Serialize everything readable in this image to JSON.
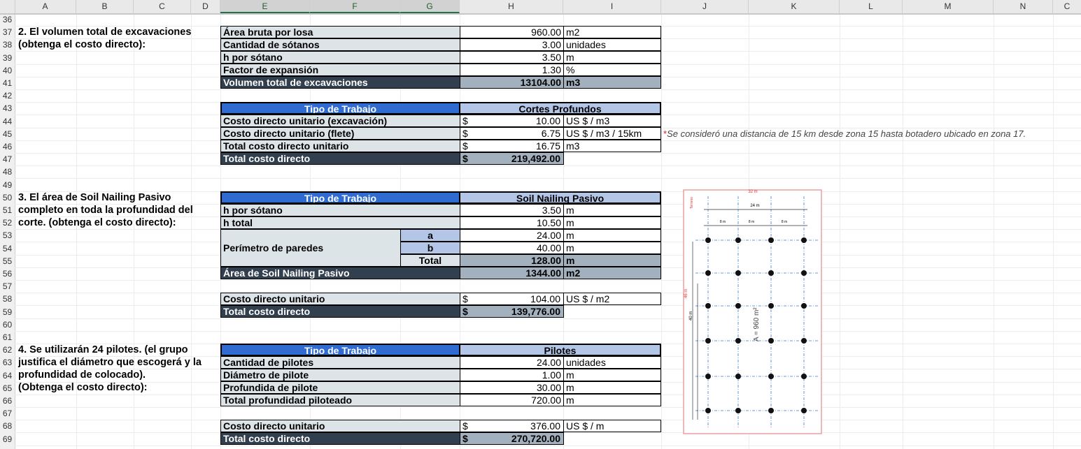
{
  "columns": [
    "A",
    "B",
    "C",
    "D",
    "E",
    "F",
    "G",
    "H",
    "I",
    "J",
    "K",
    "L",
    "M",
    "N",
    "C"
  ],
  "rows": [
    "36",
    "37",
    "38",
    "39",
    "40",
    "41",
    "42",
    "43",
    "44",
    "45",
    "46",
    "47",
    "48",
    "49",
    "50",
    "51",
    "52",
    "53",
    "54",
    "55",
    "56",
    "57",
    "58",
    "59",
    "60",
    "61",
    "62",
    "63",
    "64",
    "65",
    "66",
    "67",
    "68",
    "69"
  ],
  "q2": {
    "text1": "2. El volumen total de excavaciones",
    "text2": "(obtenga el costo directo):",
    "rows": [
      {
        "label": "Área bruta por losa",
        "value": "960.00",
        "unit": "m2"
      },
      {
        "label": "Cantidad de sótanos",
        "value": "3.00",
        "unit": "unidades"
      },
      {
        "label": "h por sótano",
        "value": "3.50",
        "unit": "m"
      },
      {
        "label": "Factor de expansión",
        "value": "1.30",
        "unit": "%"
      }
    ],
    "total": {
      "label": "Volumen total de excavaciones",
      "value": "13104.00",
      "unit": "m3"
    },
    "header": {
      "left": "Tipo de Trabajo",
      "right": "Cortes Profundos"
    },
    "cost_rows": [
      {
        "label": "Costo directo unitario (excavación)",
        "currency": "$",
        "value": "10.00",
        "unit": "US $ / m3"
      },
      {
        "label": "Costo directo unitario (flete)",
        "currency": "$",
        "value": "6.75",
        "unit": "US $ / m3 / 15km"
      },
      {
        "label": "Total costo directo unitario",
        "currency": "$",
        "value": "16.75",
        "unit": "m3"
      }
    ],
    "cost_total": {
      "label": "Total costo directo",
      "currency": "$",
      "value": "219,492.00"
    },
    "note_star": "*",
    "note": "Se consideró una distancia de 15 km desde zona 15 hasta botadero ubicado en zona 17."
  },
  "q3": {
    "text1": "3. El área de Soil Nailing Pasivo",
    "text2": "completo en toda la profundidad del",
    "text3": "corte. (obtenga el costo directo):",
    "header": {
      "left": "Tipo de Trabajo",
      "right": "Soil Nailing Pasivo"
    },
    "rows": [
      {
        "label": "h por sótano",
        "value": "3.50",
        "unit": "m"
      },
      {
        "label": "h total",
        "value": "10.50",
        "unit": "m"
      }
    ],
    "perimeter": {
      "label": "Perímetro de paredes",
      "a_label": "a",
      "a_value": "24.00",
      "a_unit": "m",
      "b_label": "b",
      "b_value": "40.00",
      "b_unit": "m",
      "total_label": "Total",
      "total_value": "128.00",
      "total_unit": "m"
    },
    "area": {
      "label": "Área de Soil Nailing Pasivo",
      "value": "1344.00",
      "unit": "m2"
    },
    "unit_cost": {
      "label": "Costo directo unitario",
      "currency": "$",
      "value": "104.00",
      "unit": "US $ / m2"
    },
    "cost_total": {
      "label": "Total costo directo",
      "currency": "$",
      "value": "139,776.00"
    }
  },
  "q4": {
    "text1": "4. Se utilizarán 24 pilotes. (el grupo",
    "text2": "justifica el diámetro que escogerá y la",
    "text3": "profundidad de colocado).",
    "text4": "(Obtenga el costo directo):",
    "header": {
      "left": "Tipo de Trabajo",
      "right": "Pilotes"
    },
    "rows": [
      {
        "label": "Cantidad de pilotes",
        "value": "24.00",
        "unit": "unidades"
      },
      {
        "label": "Diámetro de pilote",
        "value": "1.00",
        "unit": "m"
      },
      {
        "label": "Profundida de pilote",
        "value": "30.00",
        "unit": "m"
      },
      {
        "label": "Total profundidad piloteado",
        "value": "720.00",
        "unit": "m"
      }
    ],
    "unit_cost": {
      "label": "Costo directo unitario",
      "currency": "$",
      "value": "376.00",
      "unit": "US $ / m"
    },
    "cost_total": {
      "label": "Total costo directo",
      "currency": "$",
      "value": "270,720.00"
    }
  },
  "drawing": {
    "top_dim": "32 m",
    "width_dim": "24 m",
    "spacing": "8 m",
    "height_dim": "46 m",
    "inner_height": "40 m",
    "area": "A = 960 m²",
    "side_label": "Terreno"
  },
  "colors": {
    "dark": "#323f4f",
    "blue": "#2f6bd0",
    "lavender": "#b4c6e7",
    "label_bg": "#dde4e8",
    "grey_total": "#a3b0bd"
  }
}
